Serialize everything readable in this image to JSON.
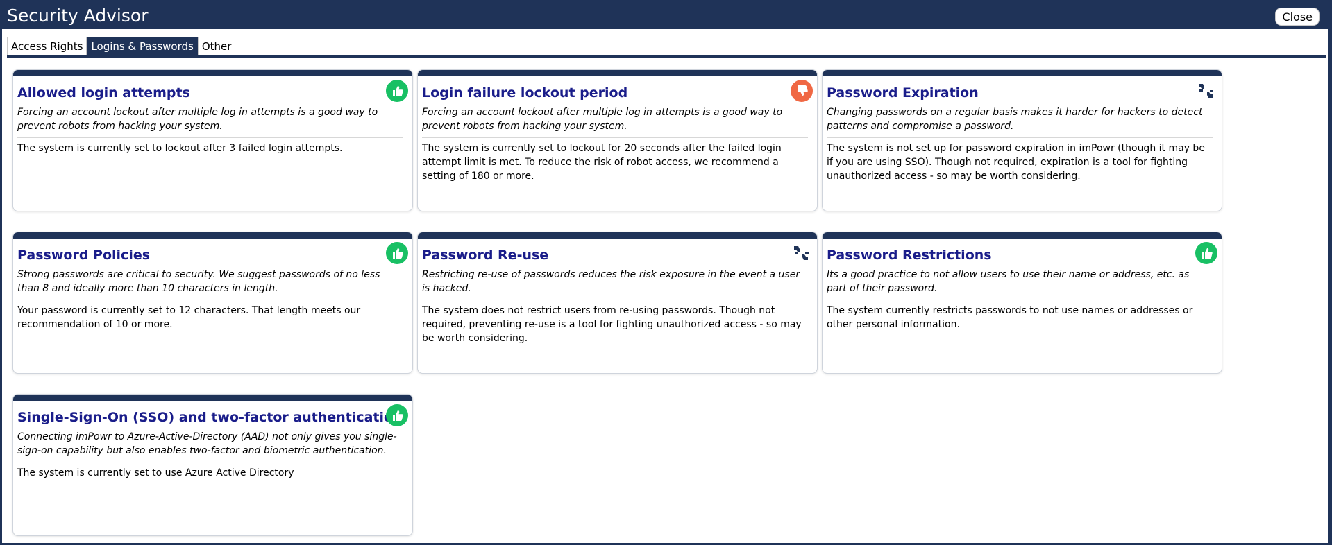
{
  "window": {
    "title": "Security Advisor",
    "close_label": "Close"
  },
  "tabs": [
    {
      "label": "Access Rights",
      "active": false
    },
    {
      "label": "Logins & Passwords",
      "active": true
    },
    {
      "label": "Other",
      "active": false
    }
  ],
  "colors": {
    "header": "#1f3358",
    "title_text": "#1a1d8a",
    "good": "#18c064",
    "bad": "#f06844",
    "neutral": "#1f3358"
  },
  "cards": [
    {
      "title": "Allowed login attempts",
      "description": "Forcing an account lockout after multiple log in attempts is a good way to prevent robots from hacking your system.",
      "status": "The system is currently set to lockout after 3 failed login attempts.",
      "rating": "thumbs-up-icon"
    },
    {
      "title": "Login failure lockout period",
      "description": "Forcing an account lockout after multiple log in attempts is a good way to prevent robots from hacking your system.",
      "status": "The system is currently set to lockout for 20 seconds after the failed login attempt limit is met. To reduce the risk of robot access, we recommend a setting of 180 or more.",
      "rating": "thumbs-down-icon"
    },
    {
      "title": "Password Expiration",
      "description": "Changing passwords on a regular basis makes it harder for hackers to detect patterns and compromise a password.",
      "status": "The system is not set up for password expiration in imPowr (though it may be if you are using SSO). Though not required, expiration is a tool for fighting unauthorized access - so may be worth considering.",
      "rating": "thumbs-sideways-icon"
    },
    {
      "title": "Password Policies",
      "description": "Strong passwords are critical to security. We suggest passwords of no less than 8 and ideally more than 10 characters in length.",
      "status": "Your password is currently set to 12 characters. That length meets our recommendation of 10 or more.",
      "rating": "thumbs-up-icon"
    },
    {
      "title": "Password Re-use",
      "description": "Restricting re-use of passwords reduces the risk exposure in the event a user is hacked.",
      "status": "The system does not restrict users from re-using passwords. Though not required, preventing re-use is a tool for fighting unauthorized access - so may be worth considering.",
      "rating": "thumbs-sideways-icon"
    },
    {
      "title": "Password Restrictions",
      "description": "Its a good practice to not allow users to use their name or address, etc. as part of their password.",
      "status": "The system currently restricts passwords to not use names or addresses or other personal information.",
      "rating": "thumbs-up-icon"
    },
    {
      "title": "Single-Sign-On (SSO) and two-factor authentication",
      "description": "Connecting imPowr to Azure-Active-Directory (AAD) not only gives you single-sign-on capability but also enables two-factor and biometric authentication.",
      "status": "The system is currently set to use Azure Active Directory",
      "rating": "thumbs-up-icon"
    }
  ]
}
